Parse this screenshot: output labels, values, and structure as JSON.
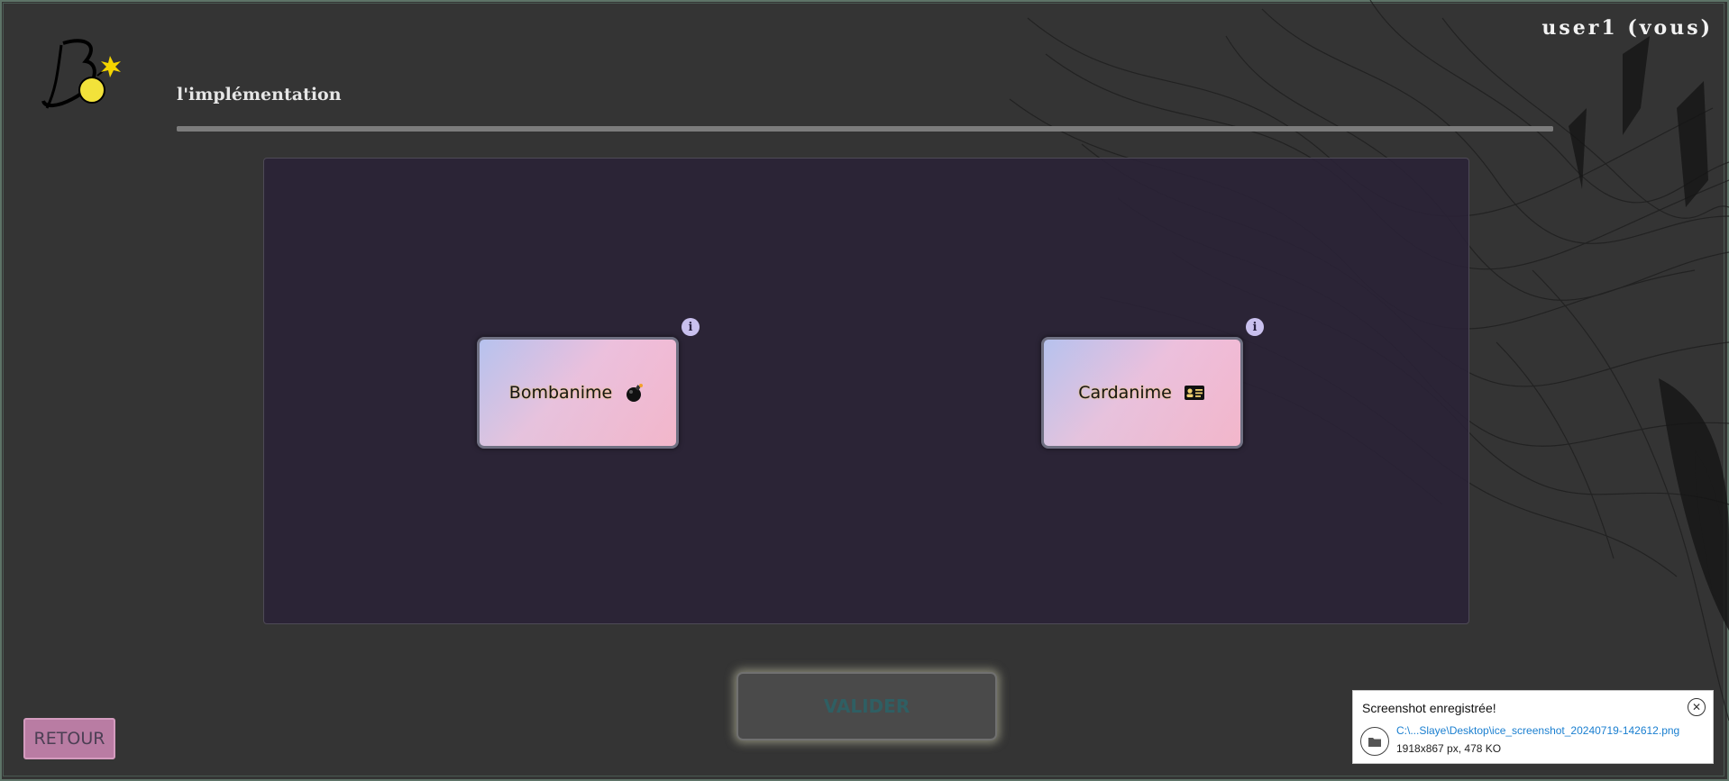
{
  "header": {
    "user_label": "user1 (vous)",
    "page_title": "l'implémentation",
    "progress_fraction": 1.0
  },
  "games": [
    {
      "label": "Bombanime",
      "icon": "bomb-icon"
    },
    {
      "label": "Cardanime",
      "icon": "id-card-icon"
    }
  ],
  "actions": {
    "validate_label": "VALIDER",
    "back_label": "RETOUR"
  },
  "toast": {
    "title": "Screenshot enregistrée!",
    "path": "C:\\...Slaye\\Desktop\\ice_screenshot_20240719-142612.png",
    "meta": "1918x867 px, 478 KO"
  },
  "colors": {
    "background": "#343434",
    "panel": "#2a2237",
    "back_button": "#b97ca3",
    "validate_text": "#2f5f63",
    "info_badge": "#c9c0ee"
  }
}
